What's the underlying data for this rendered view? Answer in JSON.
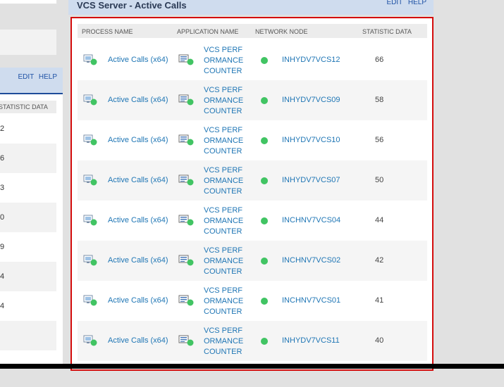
{
  "left_panel": {
    "links": {
      "edit": "EDIT",
      "help": "HELP"
    },
    "column_header": "STATISTIC DATA",
    "rows": [
      "2",
      "6",
      "3",
      "0",
      "9",
      "4",
      "4",
      ""
    ]
  },
  "main_panel": {
    "title": "VCS Server - Active Calls",
    "links": {
      "edit": "EDIT",
      "help": "HELP"
    },
    "columns": {
      "process_name": "PROCESS NAME",
      "application_name": "APPLICATION NAME",
      "network_node": "NETWORK NODE",
      "statistic_data": "STATISTIC DATA"
    },
    "rows": [
      {
        "process": "Active Calls (x64)",
        "application": "VCS PERFORMANCE COUNTER",
        "node": "INHYDV7VCS12",
        "value": "66"
      },
      {
        "process": "Active Calls (x64)",
        "application": "VCS PERFORMANCE COUNTER",
        "node": "INHYDV7VCS09",
        "value": "58"
      },
      {
        "process": "Active Calls (x64)",
        "application": "VCS PERFORMANCE COUNTER",
        "node": "INHYDV7VCS10",
        "value": "56"
      },
      {
        "process": "Active Calls (x64)",
        "application": "VCS PERFORMANCE COUNTER",
        "node": "INHYDV7VCS07",
        "value": "50"
      },
      {
        "process": "Active Calls (x64)",
        "application": "VCS PERFORMANCE COUNTER",
        "node": "INCHNV7VCS04",
        "value": "44"
      },
      {
        "process": "Active Calls (x64)",
        "application": "VCS PERFORMANCE COUNTER",
        "node": "INCHNV7VCS02",
        "value": "42"
      },
      {
        "process": "Active Calls (x64)",
        "application": "VCS PERFORMANCE COUNTER",
        "node": "INCHNV7VCS01",
        "value": "41"
      },
      {
        "process": "Active Calls (x64)",
        "application": "VCS PERFORMANCE COUNTER",
        "node": "INHYDV7VCS11",
        "value": "40"
      }
    ]
  },
  "colors": {
    "accent": "#1f76b5",
    "status_ok": "#41c463",
    "highlight_border": "#d40b0b",
    "header_bg": "#cfdcee"
  },
  "icons": {
    "process": "process-status-icon",
    "application": "app-monitor-icon",
    "status": "status-up-icon"
  }
}
